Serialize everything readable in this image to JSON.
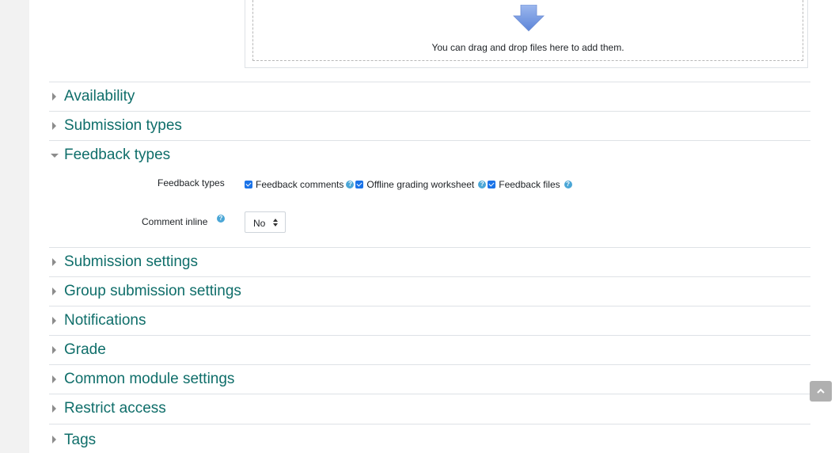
{
  "filepicker": {
    "drop_text": "You can drag and drop files here to add them."
  },
  "sections": {
    "availability": "Availability",
    "submission_types": "Submission types",
    "feedback_types": "Feedback types",
    "submission_settings": "Submission settings",
    "group_submission_settings": "Group submission settings",
    "notifications": "Notifications",
    "grade": "Grade",
    "common_module_settings": "Common module settings",
    "restrict_access": "Restrict access",
    "tags": "Tags"
  },
  "feedback": {
    "types_label": "Feedback types",
    "options": [
      {
        "label": "Feedback comments",
        "checked": true
      },
      {
        "label": "Offline grading worksheet",
        "checked": true
      },
      {
        "label": "Feedback files",
        "checked": true
      }
    ],
    "comment_inline_label": "Comment inline",
    "comment_inline_value": "No",
    "help_glyph": "?"
  },
  "icons": {
    "drop_arrow": "down-arrow-icon",
    "help": "help-icon",
    "scroll_top": "chevron-up-icon"
  },
  "colors": {
    "section_title": "#0f6e6a",
    "checkbox": "#1a73e8",
    "help_icon": "#4aa6d6",
    "arrow": "#7b9fe0"
  }
}
